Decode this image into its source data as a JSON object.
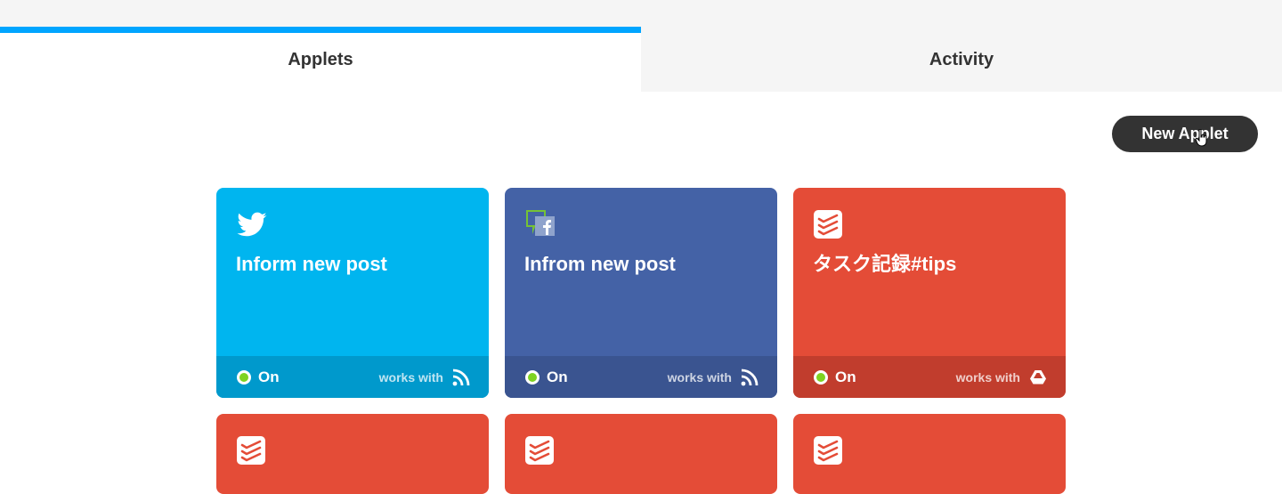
{
  "tabs": [
    {
      "label": "Applets",
      "active": true
    },
    {
      "label": "Activity",
      "active": false
    }
  ],
  "new_applet_button": "New Applet",
  "colors": {
    "accent": "#00a5ff",
    "twitter": "#00b5ef",
    "twitter_footer": "#0099cc",
    "facebook": "#4462a6",
    "facebook_footer": "#3a5490",
    "todoist": "#e44c37",
    "todoist_footer": "#c13d2d",
    "status_on": "#7ed321"
  },
  "applets": [
    {
      "title": "Inform new post",
      "icon": "twitter-bird-icon",
      "status": "On",
      "works_with": "works with",
      "service_icon": "rss-icon"
    },
    {
      "title": "Infrom new post",
      "icon": "facebook-pages-icon",
      "status": "On",
      "works_with": "works with",
      "service_icon": "rss-icon"
    },
    {
      "title": "タスク記録#tips",
      "icon": "todoist-icon",
      "status": "On",
      "works_with": "works with",
      "service_icon": "google-drive-icon"
    },
    {
      "icon": "todoist-icon"
    },
    {
      "icon": "todoist-icon"
    },
    {
      "icon": "todoist-icon"
    }
  ]
}
